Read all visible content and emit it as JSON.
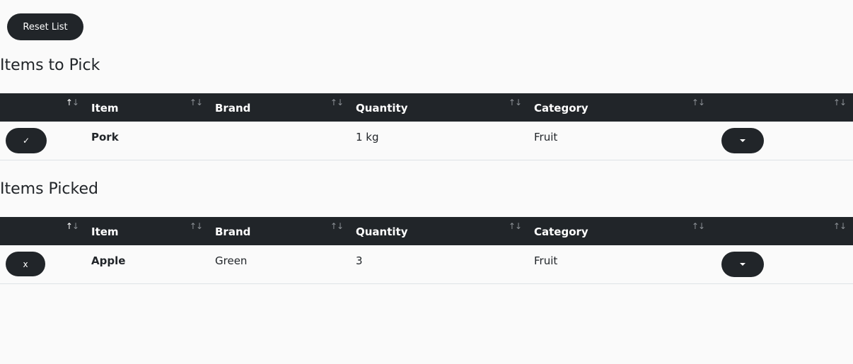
{
  "reset_button": "Reset List",
  "to_pick": {
    "title": "Items to Pick",
    "columns": [
      "",
      "Item",
      "Brand",
      "Quantity",
      "Category",
      ""
    ],
    "rows": [
      {
        "action": "✓",
        "item": "Pork",
        "brand": "",
        "quantity": "1 kg",
        "category": "Fruit"
      }
    ]
  },
  "picked": {
    "title": "Items Picked",
    "columns": [
      "",
      "Item",
      "Brand",
      "Quantity",
      "Category",
      ""
    ],
    "rows": [
      {
        "action": "x",
        "item": "Apple",
        "brand": "Green",
        "quantity": "3",
        "category": "Fruit"
      }
    ]
  },
  "icons": {
    "sort": "sort-icon",
    "menu": "caret-down-icon"
  },
  "colors": {
    "header_bg": "#212529",
    "button_bg": "#212529",
    "page_bg": "#fafafa"
  }
}
